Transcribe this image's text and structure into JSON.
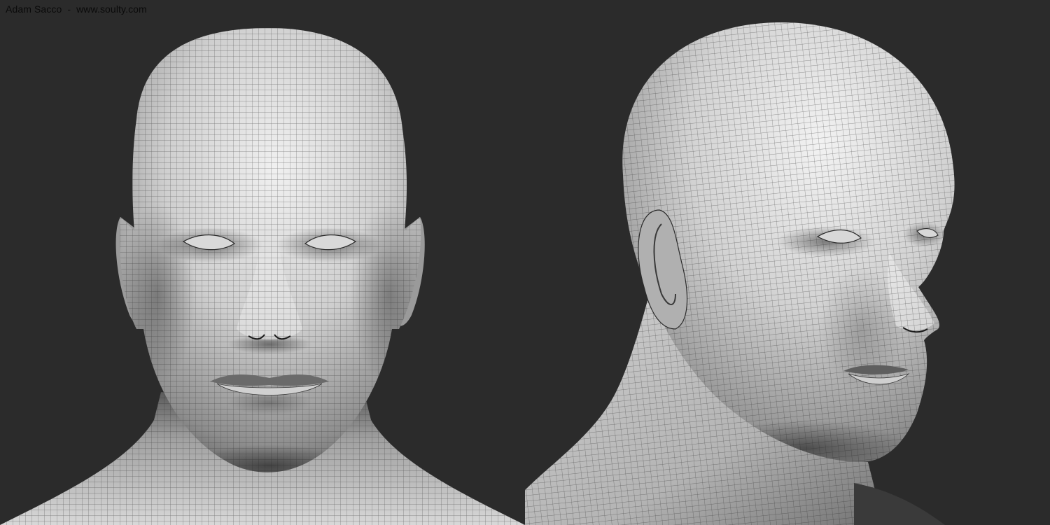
{
  "credit": {
    "text": "Adam Sacco  -  www.soulty.com"
  },
  "colors": {
    "background": "#2b2b2b",
    "skin_light": "#e6e6e6",
    "skin_mid": "#a8a8a8",
    "skin_dark": "#4a4a4a",
    "wireframe": "#1e1e1e",
    "credit_text": "#0a0a0a"
  },
  "views": [
    {
      "id": "front",
      "description_icon": "head-front-view"
    },
    {
      "id": "three-quarter",
      "description_icon": "head-three-quarter-view"
    }
  ]
}
